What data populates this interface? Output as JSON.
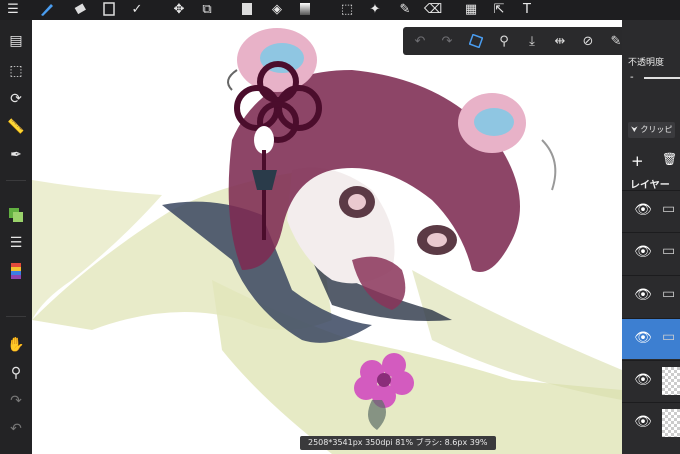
{
  "toolbar": {
    "icons": [
      "menu-icon",
      "brush-icon",
      "eraser-icon",
      "fill-rect-icon",
      "select-check-icon",
      "move-icon",
      "transform-icon",
      "color-rect-icon",
      "bucket-icon",
      "gradient-icon",
      "lasso-select-icon",
      "magic-wand-icon",
      "select-pen-icon",
      "select-eraser-icon",
      "layout-icon",
      "cursor-icon",
      "text-icon"
    ]
  },
  "left_tools": {
    "icons": [
      "pages-icon",
      "select-dashed-icon",
      "rotate-icon",
      "ruler-icon",
      "pen-fill-icon",
      "layers-color-icon",
      "list-icon",
      "palette-icon",
      "hand-icon",
      "eyedropper-icon",
      "redo-icon",
      "undo-icon"
    ]
  },
  "float_toolbar": {
    "icons": [
      "undo-icon",
      "redo-icon",
      "transform-icon",
      "eyedropper-icon",
      "save-icon",
      "flip-icon",
      "no-snap-icon",
      "edit-icon",
      "close-icon"
    ]
  },
  "right_panel": {
    "opacity_label": "不透明度",
    "opacity_minus": "-",
    "clip_button": "クリッピ",
    "add_layer": "+",
    "delete_layer": "🗑",
    "layers_label": "レイヤー"
  },
  "status": {
    "text": "2508*3541px 350dpi 81% ブラシ: 8.6px 39%"
  },
  "colors": {
    "accent": "#3d7fd1",
    "hair": "#7d2b52",
    "bun": "#e8b2c8",
    "bun_center": "#8fc6e2",
    "ribbon": "#4b0d2c",
    "flower": "#d35bbf",
    "sleeve": "#dfe3b3",
    "collar": "#2b3446"
  }
}
